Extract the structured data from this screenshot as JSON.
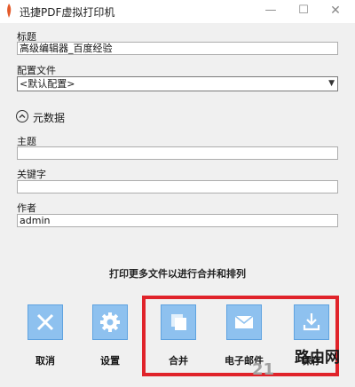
{
  "window": {
    "title": "迅捷PDF虚拟打印机",
    "minimize": "—",
    "maximize": "☐",
    "close": "✕"
  },
  "form": {
    "title_label": "标题",
    "title_value": "高级编辑器_百度经验",
    "profile_label": "配置文件",
    "profile_value": "<默认配置>",
    "metadata_label": "元数据",
    "subject_label": "主题",
    "subject_value": "",
    "keywords_label": "关键字",
    "keywords_value": "",
    "author_label": "作者",
    "author_value": "admin"
  },
  "hint": "打印更多文件以进行合并和排列",
  "actions": [
    {
      "label": "取消",
      "icon": "close-icon"
    },
    {
      "label": "设置",
      "icon": "gear-icon"
    },
    {
      "label": "合并",
      "icon": "merge-icon"
    },
    {
      "label": "电子邮件",
      "icon": "email-icon"
    },
    {
      "label": "保存",
      "icon": "download-icon"
    }
  ],
  "watermark": {
    "number": "21",
    "text": "路由网"
  },
  "colors": {
    "accent": "#8ec1ef",
    "highlight": "#e0232a",
    "background": "#f0f0f0"
  }
}
